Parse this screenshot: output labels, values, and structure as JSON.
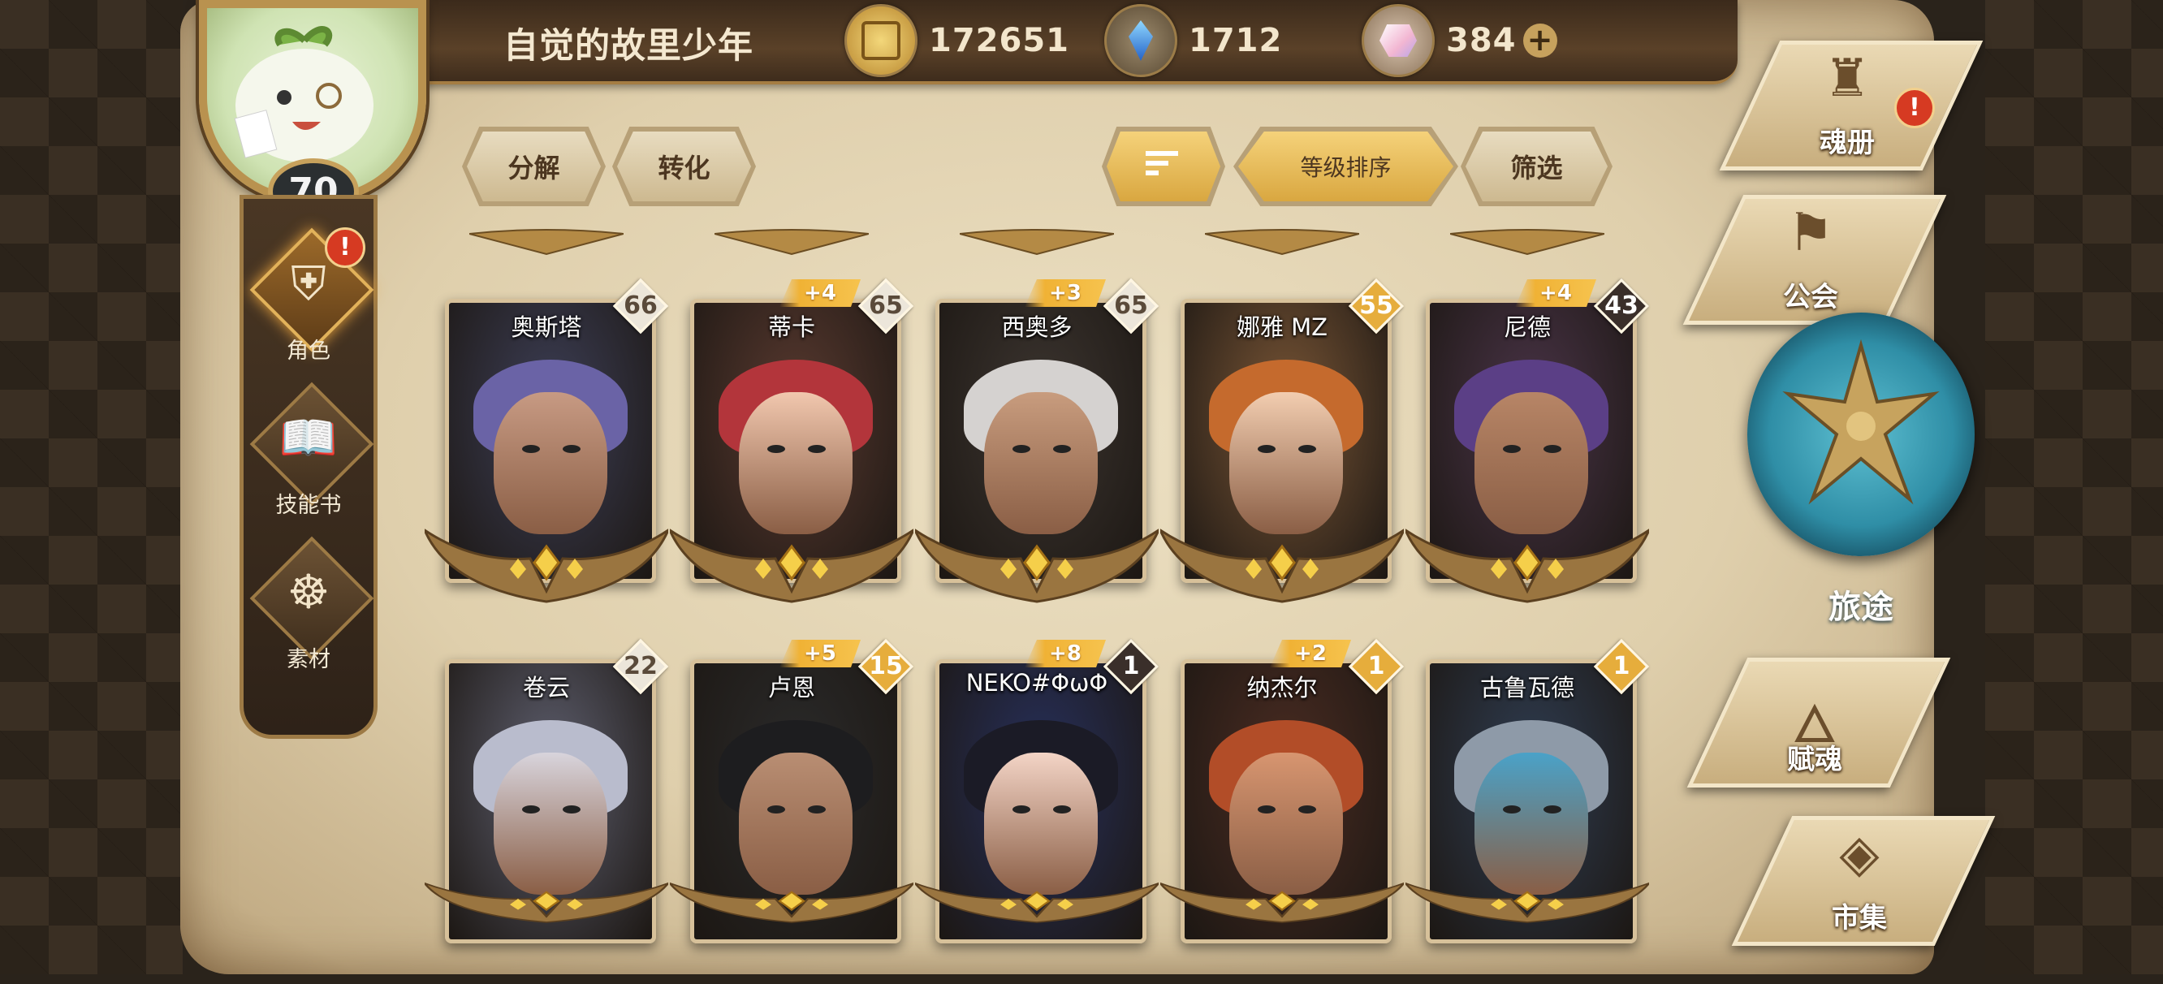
{
  "header": {
    "player_name": "自觉的故里少年",
    "player_level": "70",
    "currencies": [
      {
        "icon": "gold-coin-icon",
        "value": "172651"
      },
      {
        "icon": "blue-crystal-icon",
        "value": "1712"
      },
      {
        "icon": "pink-gem-icon",
        "value": "384"
      }
    ],
    "add_label": "+"
  },
  "left_menu": {
    "alert": "!",
    "items": [
      {
        "label": "角色",
        "icon": "helmet-icon"
      },
      {
        "label": "技能书",
        "icon": "skill-book-icon"
      },
      {
        "label": "素材",
        "icon": "material-icon"
      }
    ]
  },
  "toolbar": {
    "decompose": "分解",
    "convert": "转化",
    "sort_order": "等级排序",
    "filter": "筛选"
  },
  "heroes": [
    {
      "name": "奥斯塔",
      "level": "66",
      "plus": "",
      "level_style": "silver",
      "colors": {
        "bg": "#3d3f57",
        "hair": "#6a63a6",
        "skin": "#c79a83"
      }
    },
    {
      "name": "蒂卡",
      "level": "65",
      "plus": "+4",
      "level_style": "silver",
      "colors": {
        "bg": "#5a3a30",
        "hair": "#b3353b",
        "skin": "#f1c7ae"
      }
    },
    {
      "name": "西奥多",
      "level": "65",
      "plus": "+3",
      "level_style": "silver",
      "colors": {
        "bg": "#3c3530",
        "hair": "#d5d2d0",
        "skin": "#c89c7e"
      }
    },
    {
      "name": "娜雅 MZ",
      "level": "55",
      "plus": "",
      "level_style": "gold",
      "colors": {
        "bg": "#7a5636",
        "hair": "#c56a2d",
        "skin": "#f2cdb0"
      }
    },
    {
      "name": "尼德",
      "level": "43",
      "plus": "+4",
      "level_style": "dark",
      "colors": {
        "bg": "#4a3448",
        "hair": "#5b3f86",
        "skin": "#b78566"
      }
    },
    {
      "name": "卷云",
      "level": "22",
      "plus": "",
      "level_style": "silver",
      "colors": {
        "bg": "#5f6070",
        "hair": "#b9bccd",
        "skin": "#d8d4dc"
      }
    },
    {
      "name": "卢恩",
      "level": "15",
      "plus": "+5",
      "level_style": "gold",
      "colors": {
        "bg": "#2b2b2b",
        "hair": "#1d1d1f",
        "skin": "#b98e73"
      }
    },
    {
      "name": "NEKO#ΦωΦ",
      "level": "1",
      "plus": "+8",
      "level_style": "dark",
      "colors": {
        "bg": "#27305c",
        "hair": "#1b1b26",
        "skin": "#f3d4c6"
      }
    },
    {
      "name": "纳杰尔",
      "level": "1",
      "plus": "+2",
      "level_style": "gold",
      "colors": {
        "bg": "#4b2c22",
        "hair": "#b24d28",
        "skin": "#d79570"
      }
    },
    {
      "name": "古鲁瓦德",
      "level": "1",
      "plus": "",
      "level_style": "gold",
      "colors": {
        "bg": "#2f3d52",
        "hair": "#8e9aa8",
        "skin": "#4aa2c8"
      }
    }
  ],
  "right_nav": {
    "alert": "!",
    "items": [
      {
        "label": "魂册",
        "icon": "soul-book-icon"
      },
      {
        "label": "公会",
        "icon": "guild-banner-icon"
      },
      {
        "label": "旅途",
        "icon": "journey-emblem-icon"
      },
      {
        "label": "赋魂",
        "icon": "soul-flame-icon"
      },
      {
        "label": "市集",
        "icon": "market-crystal-icon"
      }
    ]
  },
  "colors": {
    "gold": "#d9a740",
    "silver_badge": "#e8e2d6",
    "dark_badge": "#3a2f2a",
    "alert_red": "#d63a22"
  }
}
